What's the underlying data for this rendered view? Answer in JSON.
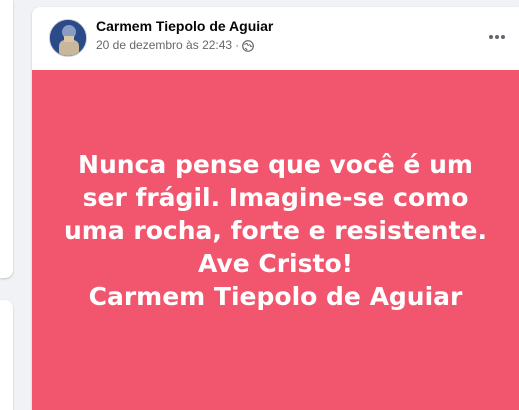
{
  "post": {
    "author": "Carmem Tiepolo de Aguiar",
    "timestamp": "20 de dezembro às 22:43",
    "separator": "·",
    "privacy_icon": "globe-icon",
    "more_icon": "more-options-icon",
    "background_color": "#f2566e",
    "text_lines": [
      "Nunca pense que você é um",
      "ser frágil. Imagine-se como",
      "uma rocha, forte e resistente.",
      "Ave Cristo!",
      "Carmem Tiepolo de Aguiar"
    ]
  }
}
